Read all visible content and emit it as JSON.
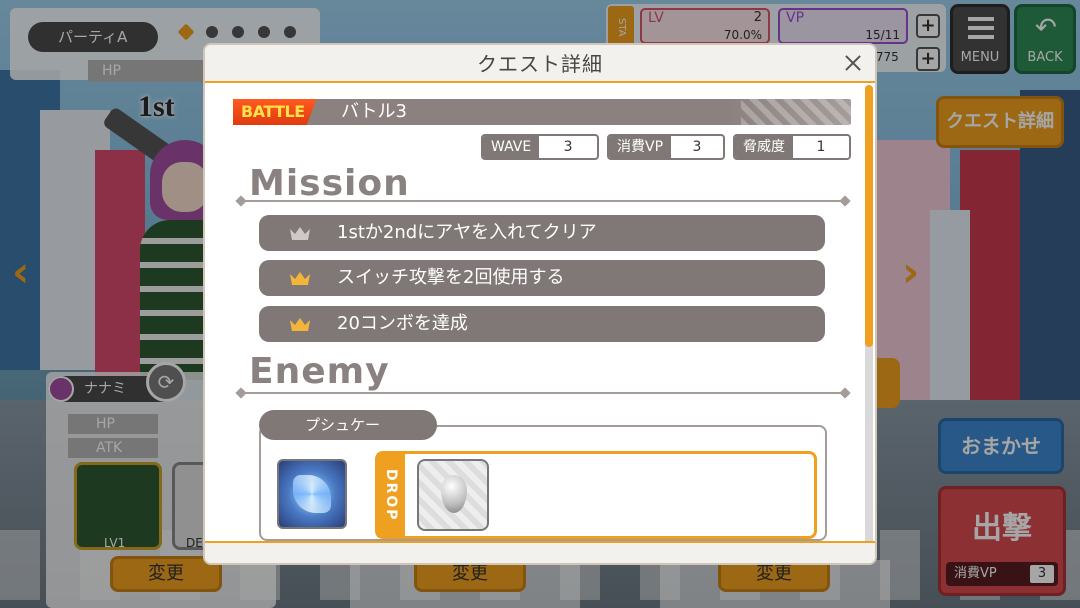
{
  "party": {
    "name": "パーティA",
    "hp_label": "HP",
    "first_label": "1st"
  },
  "stats": {
    "tag": "STA",
    "lv_label": "LV",
    "lv_value": "2",
    "lv_percent": "70.0%",
    "vp_label": "VP",
    "vp_value": "15/11",
    "extra_value": ".775"
  },
  "menu": {
    "label": "MENU"
  },
  "back": {
    "label": "BACK"
  },
  "side": {
    "quest_detail": "クエスト詳細",
    "omakase": "おまかせ",
    "shutsugeki": "出撃",
    "vp_cost_label": "消費VP",
    "vp_cost_value": "3"
  },
  "member": {
    "name": "ナナミ",
    "hp_label": "HP",
    "atk_label": "ATK",
    "card_level": "LV1",
    "card2_label": "DE",
    "change_label": "変更"
  },
  "modal": {
    "title": "クエスト詳細",
    "battle_badge": "BATTLE",
    "battle_name": "バトル3",
    "info": [
      {
        "key": "WAVE",
        "value": "3"
      },
      {
        "key": "消費VP",
        "value": "3"
      },
      {
        "key": "脅威度",
        "value": "1"
      }
    ],
    "mission_title": "Mission",
    "missions": [
      {
        "text": "1stか2ndにアヤを入れてクリア",
        "achieved": false
      },
      {
        "text": "スイッチ攻撃を2回使用する",
        "achieved": true
      },
      {
        "text": "20コンボを達成",
        "achieved": true
      }
    ],
    "enemy_title": "Enemy",
    "enemy_name": "プシュケー",
    "drop_label": "DROP"
  },
  "colors": {
    "accent": "#f0a020",
    "panel_gray": "#807876",
    "crown_gold": "#f2b53a",
    "crown_gray": "#cfc9c6"
  }
}
